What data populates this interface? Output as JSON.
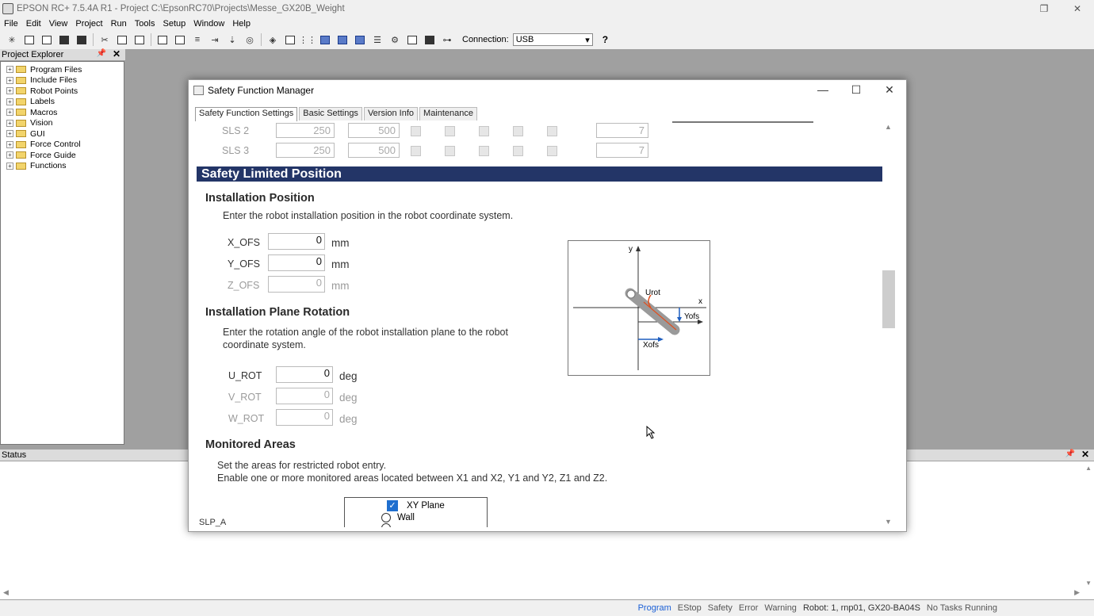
{
  "window": {
    "title": "EPSON RC+ 7.5.4A R1 - Project C:\\EpsonRC70\\Projects\\Messe_GX20B_Weight",
    "restore_glyph": "❐",
    "close_glyph": "✕"
  },
  "menu": [
    "File",
    "Edit",
    "View",
    "Project",
    "Run",
    "Tools",
    "Setup",
    "Window",
    "Help"
  ],
  "toolbar": {
    "connection_label": "Connection:",
    "connection_value": "USB",
    "help_glyph": "?"
  },
  "project_explorer": {
    "title": "Project Explorer",
    "items": [
      "Program Files",
      "Include Files",
      "Robot Points",
      "Labels",
      "Macros",
      "Vision",
      "GUI",
      "Force Control",
      "Force Guide",
      "Functions"
    ]
  },
  "status_panel": {
    "title": "Status"
  },
  "statusbar": {
    "items": [
      "Program",
      "EStop",
      "Safety",
      "Error",
      "Warning",
      "Robot: 1, rnp01, GX20-BA04S",
      "No Tasks Running"
    ]
  },
  "dialog": {
    "title": "Safety Function Manager",
    "tabs": [
      "Safety Function Settings",
      "Basic Settings",
      "Version Info",
      "Maintenance"
    ],
    "sls_rows": [
      {
        "label": "SLS 2",
        "v1": "250",
        "v2": "500",
        "v3": "7"
      },
      {
        "label": "SLS 3",
        "v1": "250",
        "v2": "500",
        "v3": "7"
      }
    ],
    "section_title": "Safety Limited Position",
    "installation_position": {
      "heading": "Installation Position",
      "description": "Enter the robot installation position in the robot coordinate system.",
      "fields": [
        {
          "label": "X_OFS",
          "value": "0",
          "unit": "mm"
        },
        {
          "label": "Y_OFS",
          "value": "0",
          "unit": "mm"
        },
        {
          "label": "Z_OFS",
          "value": "0",
          "unit": "mm"
        }
      ]
    },
    "installation_plane_rotation": {
      "heading": "Installation Plane Rotation",
      "description_line1": "Enter the rotation angle of the robot installation plane to the robot",
      "description_line2": "coordinate system.",
      "fields": [
        {
          "label": "U_ROT",
          "value": "0",
          "unit": "deg"
        },
        {
          "label": "V_ROT",
          "value": "0",
          "unit": "deg"
        },
        {
          "label": "W_ROT",
          "value": "0",
          "unit": "deg"
        }
      ]
    },
    "diagram_labels": {
      "y": "y",
      "x": "x",
      "urot": "Urot",
      "yofs": "Yofs",
      "xofs": "Xofs"
    },
    "monitored_areas": {
      "heading": "Monitored Areas",
      "line1": "Set the areas for restricted robot entry.",
      "line2": "Enable one or more monitored areas located between X1 and X2, Y1 and Y2, Z1 and Z2.",
      "slp_label": "SLP_A",
      "options": [
        {
          "label": "XY Plane",
          "checked": true
        },
        {
          "label": "Wall",
          "checked": false
        }
      ]
    }
  }
}
